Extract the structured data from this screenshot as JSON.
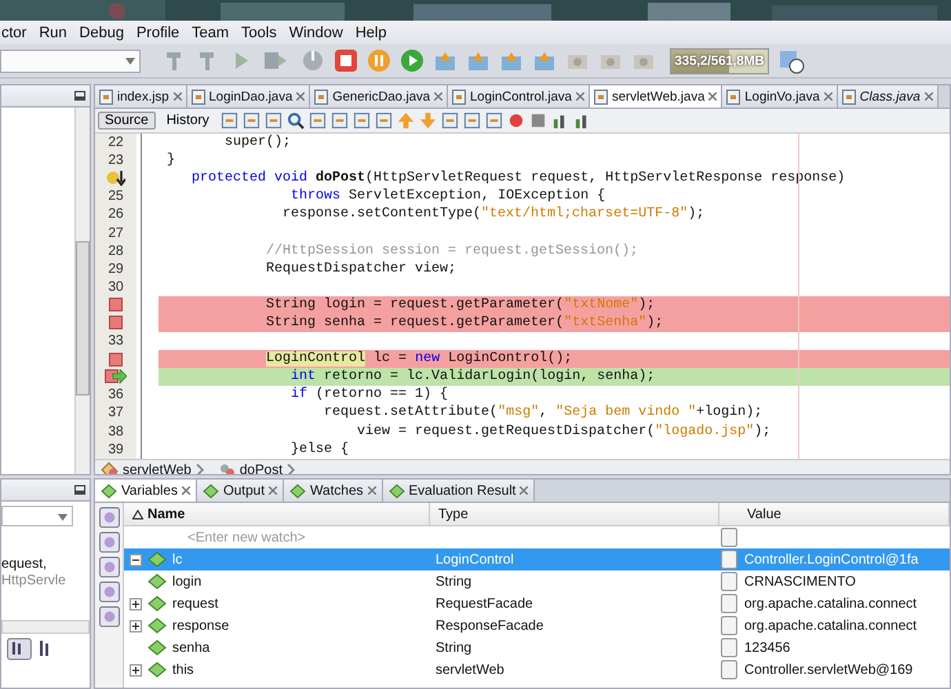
{
  "menu": [
    {
      "label": "ctor"
    },
    {
      "label": "Run"
    },
    {
      "label": "Debug"
    },
    {
      "label": "Profile"
    },
    {
      "label": "Team"
    },
    {
      "label": "Tools"
    },
    {
      "label": "Window"
    },
    {
      "label": "Help"
    }
  ],
  "memory_meter": {
    "text": "335,2/561,8MB",
    "level": 0.6
  },
  "file_tabs": [
    {
      "label": "index.jsp",
      "selected": false,
      "italic": false
    },
    {
      "label": "LoginDao.java",
      "selected": false,
      "italic": false
    },
    {
      "label": "GenericDao.java",
      "selected": false,
      "italic": false
    },
    {
      "label": "LoginControl.java",
      "selected": false,
      "italic": false
    },
    {
      "label": "servletWeb.java",
      "selected": true,
      "italic": false
    },
    {
      "label": "LoginVo.java",
      "selected": false,
      "italic": false
    },
    {
      "label": "Class.java",
      "selected": false,
      "italic": true
    }
  ],
  "view_tabs": [
    {
      "label": "Source",
      "selected": true
    },
    {
      "label": "History",
      "selected": false
    }
  ],
  "code_lines": [
    {
      "kind": "number",
      "number": "22",
      "segs": [
        {
          "text": "        super();",
          "kind": "plain"
        }
      ]
    },
    {
      "kind": "number",
      "number": "23",
      "segs": [
        {
          "text": " }",
          "kind": "plain"
        }
      ]
    },
    {
      "kind": "hint",
      "segs": [
        {
          "text": "    protected void ",
          "kind": "keyword"
        },
        {
          "text": "doPost",
          "kind": "bold"
        },
        {
          "text": "(HttpServletRequest request, HttpServletResponse response)",
          "kind": "plain"
        }
      ]
    },
    {
      "kind": "number",
      "number": "25",
      "segs": [
        {
          "text": "                throws",
          "kind": "keyword"
        },
        {
          "text": " ServletException, IOException {",
          "kind": "plain"
        }
      ]
    },
    {
      "kind": "number",
      "number": "26",
      "segs": [
        {
          "text": "               response.setContentType(",
          "kind": "plain"
        },
        {
          "text": "\"text/html;charset=UTF-8\"",
          "kind": "string"
        },
        {
          "text": ");",
          "kind": "plain"
        }
      ]
    },
    {
      "kind": "number",
      "number": "27"
    },
    {
      "kind": "number",
      "number": "28",
      "segs": [
        {
          "text": "             //HttpSession session = request.getSession();",
          "kind": "comment"
        }
      ]
    },
    {
      "kind": "number",
      "number": "29",
      "segs": [
        {
          "text": "             RequestDispatcher view;",
          "kind": "plain"
        }
      ]
    },
    {
      "kind": "number",
      "number": "30"
    },
    {
      "kind": "breakpoint",
      "segs": [
        {
          "text": "             String login = request.getParameter(",
          "kind": "plain"
        },
        {
          "text": "\"txtNome\"",
          "kind": "string"
        },
        {
          "text": ");",
          "kind": "plain"
        }
      ]
    },
    {
      "kind": "breakpoint",
      "segs": [
        {
          "text": "             String senha = request.getParameter(",
          "kind": "plain"
        },
        {
          "text": "\"txtSenha\"",
          "kind": "string"
        },
        {
          "text": ");",
          "kind": "plain"
        }
      ]
    },
    {
      "kind": "number",
      "number": "33"
    },
    {
      "kind": "breakpoint",
      "segs": [
        {
          "text": "             LoginControl",
          "kind": "highlight"
        },
        {
          "text": " lc = ",
          "kind": "plain"
        },
        {
          "text": "new",
          "kind": "keyword"
        },
        {
          "text": " LoginControl();",
          "kind": "plain"
        }
      ]
    },
    {
      "kind": "current",
      "segs": [
        {
          "text": "                int",
          "kind": "keyword"
        },
        {
          "text": " retorno = lc.ValidarLogin(login, senha);",
          "kind": "plain"
        }
      ]
    },
    {
      "kind": "number",
      "number": "36",
      "segs": [
        {
          "text": "                if",
          "kind": "keyword"
        },
        {
          "text": " (retorno == 1) {",
          "kind": "plain"
        }
      ]
    },
    {
      "kind": "number",
      "number": "37",
      "segs": [
        {
          "text": "                    request.setAttribute(",
          "kind": "plain"
        },
        {
          "text": "\"msg\"",
          "kind": "string"
        },
        {
          "text": ", ",
          "kind": "plain"
        },
        {
          "text": "\"Seja bem vindo \"",
          "kind": "string"
        },
        {
          "text": "+login);",
          "kind": "plain"
        }
      ]
    },
    {
      "kind": "number",
      "number": "38",
      "segs": [
        {
          "text": "                        view = request.getRequestDispatcher(",
          "kind": "plain"
        },
        {
          "text": "\"logado.jsp\"",
          "kind": "string"
        },
        {
          "text": ");",
          "kind": "plain"
        }
      ]
    },
    {
      "kind": "number",
      "number": "39",
      "segs": [
        {
          "text": "                }else {",
          "kind": "plain"
        }
      ]
    }
  ],
  "breadcrumb": [
    {
      "label": "servletWeb",
      "kind": "class"
    },
    {
      "label": "doPost",
      "kind": "method"
    }
  ],
  "left_lower": {
    "text": "equest,",
    "type_text": "HttpServle"
  },
  "debug_tabs": [
    {
      "label": "Variables",
      "selected": true
    },
    {
      "label": "Output",
      "selected": false
    },
    {
      "label": "Watches",
      "selected": false
    },
    {
      "label": "Evaluation Result",
      "selected": false
    }
  ],
  "variables": {
    "columns": [
      "Name",
      "Type",
      "Value"
    ],
    "watch_placeholder": "<Enter new watch>",
    "rows": [
      {
        "name": "lc",
        "type": "LoginControl",
        "value": "Controller.LoginControl@1fa",
        "kind": "expanded",
        "selected": true
      },
      {
        "name": "login",
        "type": "String",
        "value": "CRNASCIMENTO",
        "kind": "leaf",
        "selected": false
      },
      {
        "name": "request",
        "type": "RequestFacade",
        "value": "org.apache.catalina.connect",
        "kind": "collapsed",
        "selected": false
      },
      {
        "name": "response",
        "type": "ResponseFacade",
        "value": "org.apache.catalina.connect",
        "kind": "collapsed",
        "selected": false
      },
      {
        "name": "senha",
        "type": "String",
        "value": "123456",
        "kind": "leaf",
        "selected": false
      },
      {
        "name": "this",
        "type": "servletWeb",
        "value": "Controller.servletWeb@169",
        "kind": "collapsed",
        "selected": false
      }
    ]
  }
}
